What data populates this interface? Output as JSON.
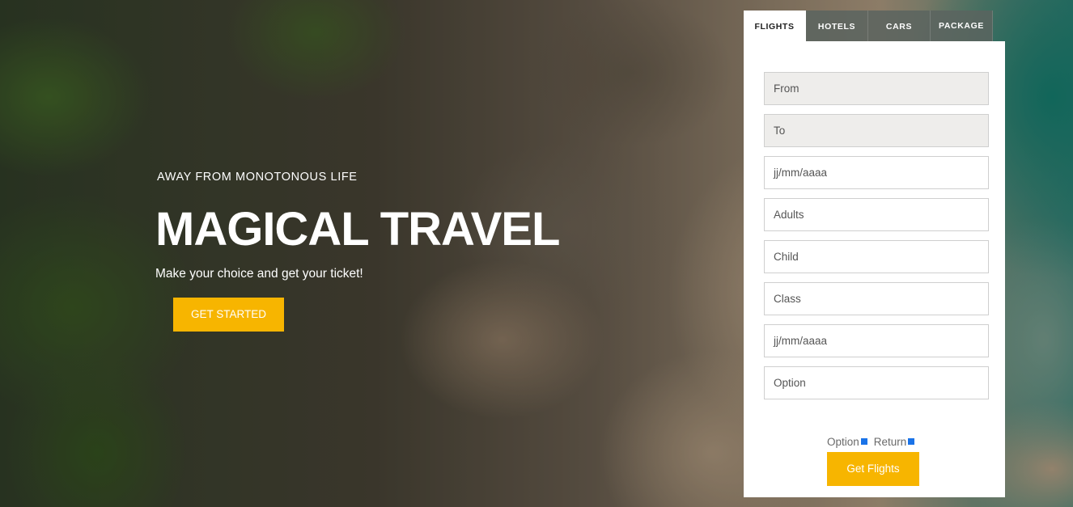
{
  "hero": {
    "eyebrow": "AWAY FROM MONOTONOUS LIFE",
    "headline": "MAGICAL TRAVEL",
    "tagline": "Make your choice and get your ticket!",
    "cta_label": "GET STARTED"
  },
  "booking": {
    "tabs": [
      {
        "label": "FLIGHTS",
        "active": true
      },
      {
        "label": "HOTELS",
        "active": false
      },
      {
        "label": "CARS",
        "active": false
      },
      {
        "label": "PACKAGE",
        "active": false
      }
    ],
    "fields": {
      "from": "From",
      "to": "To",
      "depart_date": "jj/mm/aaaa",
      "adults": "Adults",
      "child": "Child",
      "class": "Class",
      "return_date": "jj/mm/aaaa",
      "option": "Option"
    },
    "trip_types": {
      "option": "Option",
      "return": "Return"
    },
    "submit_label": "Get Flights"
  },
  "colors": {
    "accent": "#f7b500",
    "radio": "#1a73e8",
    "field_filled": "#eeedeb"
  }
}
